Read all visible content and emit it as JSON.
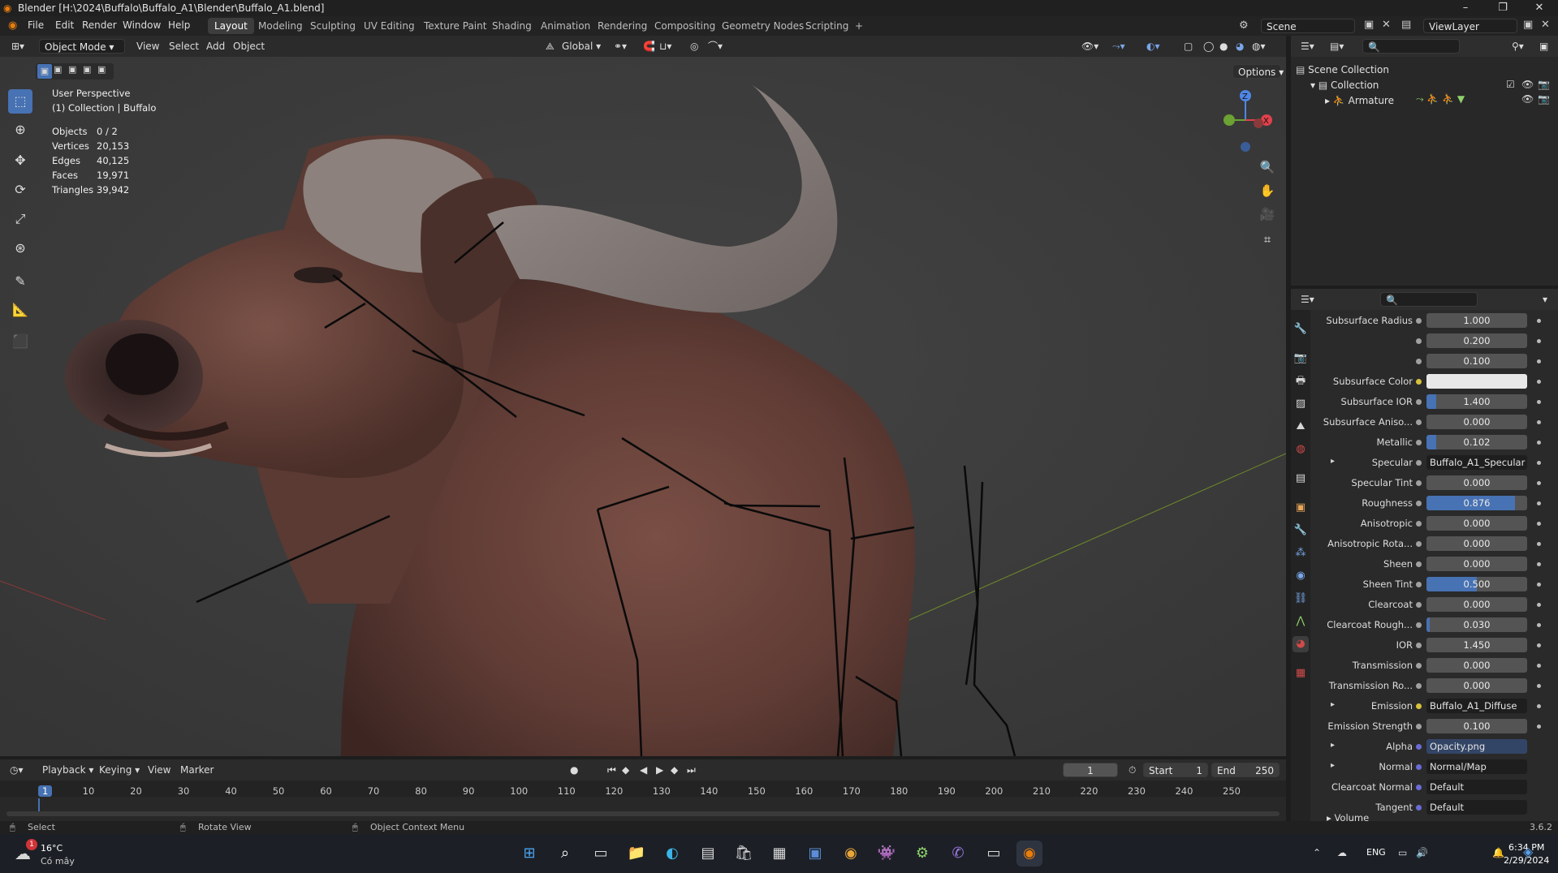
{
  "window": {
    "title": "Blender [H:\\2024\\Buffalo\\Buffalo_A1\\Blender\\Buffalo_A1.blend]",
    "controls": [
      "–",
      "❐",
      "✕"
    ]
  },
  "menu": [
    "File",
    "Edit",
    "Render",
    "Window",
    "Help"
  ],
  "workspaces": [
    "Layout",
    "Modeling",
    "Sculpting",
    "UV Editing",
    "Texture Paint",
    "Shading",
    "Animation",
    "Rendering",
    "Compositing",
    "Geometry Nodes",
    "Scripting",
    "+"
  ],
  "active_workspace": "Layout",
  "scene": {
    "label": "Scene",
    "view_layer": "ViewLayer"
  },
  "viewport_header": {
    "mode": "Object Mode",
    "menus": [
      "View",
      "Select",
      "Add",
      "Object"
    ],
    "orientation": "Global",
    "options_label": "Options"
  },
  "viewport": {
    "perspective": "User Perspective",
    "collection_line": "(1) Collection | Buffalo",
    "stats": [
      {
        "label": "Objects",
        "value": "0 / 2"
      },
      {
        "label": "Vertices",
        "value": "20,153"
      },
      {
        "label": "Edges",
        "value": "40,125"
      },
      {
        "label": "Faces",
        "value": "19,971"
      },
      {
        "label": "Triangles",
        "value": "39,942"
      }
    ],
    "gizmo_axes": {
      "z": "Z",
      "x": "X"
    }
  },
  "outliner": {
    "scene_collection": "Scene Collection",
    "collection": "Collection",
    "armature": "Armature"
  },
  "properties": {
    "rows": [
      {
        "label": "Subsurface Radius",
        "type": "value",
        "value": "1.000",
        "fill": 0
      },
      {
        "label": "",
        "type": "value",
        "value": "0.200",
        "fill": 0
      },
      {
        "label": "",
        "type": "value",
        "value": "0.100",
        "fill": 0
      },
      {
        "label": "Subsurface Color",
        "type": "color",
        "value": "",
        "dot": "#d8c13c"
      },
      {
        "label": "Subsurface IOR",
        "type": "value",
        "value": "1.400",
        "fill": 0.1
      },
      {
        "label": "Subsurface Aniso...",
        "type": "value",
        "value": "0.000",
        "fill": 0
      },
      {
        "label": "Metallic",
        "type": "value",
        "value": "0.102",
        "fill": 0.1
      },
      {
        "label": "Specular",
        "type": "link",
        "value": "Buffalo_A1_Specular",
        "expand": true
      },
      {
        "label": "Specular Tint",
        "type": "value",
        "value": "0.000",
        "fill": 0
      },
      {
        "label": "Roughness",
        "type": "value",
        "value": "0.876",
        "fill": 0.876
      },
      {
        "label": "Anisotropic",
        "type": "value",
        "value": "0.000",
        "fill": 0
      },
      {
        "label": "Anisotropic Rota...",
        "type": "value",
        "value": "0.000",
        "fill": 0
      },
      {
        "label": "Sheen",
        "type": "value",
        "value": "0.000",
        "fill": 0
      },
      {
        "label": "Sheen Tint",
        "type": "value",
        "value": "0.500",
        "fill": 0.5
      },
      {
        "label": "Clearcoat",
        "type": "value",
        "value": "0.000",
        "fill": 0
      },
      {
        "label": "Clearcoat Rough...",
        "type": "value",
        "value": "0.030",
        "fill": 0.03
      },
      {
        "label": "IOR",
        "type": "value",
        "value": "1.450",
        "fill": 0
      },
      {
        "label": "Transmission",
        "type": "value",
        "value": "0.000",
        "fill": 0
      },
      {
        "label": "Transmission Ro...",
        "type": "value",
        "value": "0.000",
        "fill": 0
      },
      {
        "label": "Emission",
        "type": "link",
        "value": "Buffalo_A1_Diffuse",
        "expand": true,
        "dot": "#d8c13c"
      },
      {
        "label": "Emission Strength",
        "type": "value",
        "value": "0.100",
        "fill": 0
      },
      {
        "label": "Alpha",
        "type": "link",
        "value": "Opacity.png",
        "expand": true,
        "dot": "#6b6bd8",
        "highlight": true
      },
      {
        "label": "Normal",
        "type": "link",
        "value": "Normal/Map",
        "expand": true,
        "dot": "#6b6bd8"
      },
      {
        "label": "Clearcoat Normal",
        "type": "link",
        "value": "Default",
        "dot": "#6b6bd8"
      },
      {
        "label": "Tangent",
        "type": "link",
        "value": "Default",
        "dot": "#6b6bd8"
      }
    ],
    "volume_label": "Volume"
  },
  "timeline": {
    "menus": [
      "Playback",
      "Keying",
      "View",
      "Marker"
    ],
    "current_frame": "1",
    "start_label": "Start",
    "start": "1",
    "end_label": "End",
    "end": "250",
    "ticks": [
      "1",
      "10",
      "20",
      "30",
      "40",
      "50",
      "60",
      "70",
      "80",
      "90",
      "100",
      "110",
      "120",
      "130",
      "140",
      "150",
      "160",
      "170",
      "180",
      "190",
      "200",
      "210",
      "220",
      "230",
      "240",
      "250"
    ]
  },
  "status_bar": {
    "select": "Select",
    "rotate": "Rotate View",
    "context": "Object Context Menu",
    "version": "3.6.2"
  },
  "taskbar": {
    "weather_temp": "16°C",
    "weather_text": "Có mây",
    "weather_badge": "1",
    "language": "ENG",
    "time": "6:34 PM",
    "date": "2/29/2024"
  },
  "colors": {
    "accent": "#4772b3",
    "selected_frame": "#4772b3",
    "blender_orange": "#e87d0d"
  }
}
